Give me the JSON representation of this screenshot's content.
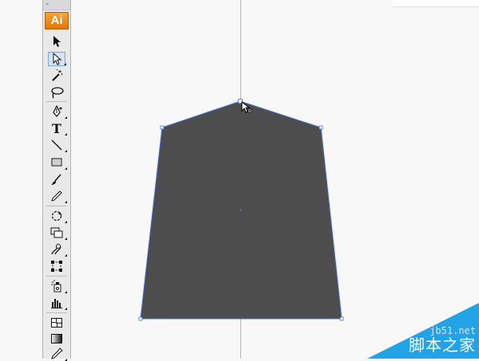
{
  "app": {
    "logo_text": "Ai",
    "toolbar_grip": "«"
  },
  "tools": [
    {
      "name": "selection-tool",
      "icon": "black-arrow-icon",
      "selected": false
    },
    {
      "name": "direct-selection-tool",
      "icon": "white-arrow-icon",
      "selected": true
    },
    {
      "name": "magic-wand-tool",
      "icon": "magic-wand-icon",
      "selected": false
    },
    {
      "name": "lasso-tool",
      "icon": "lasso-icon",
      "selected": false
    },
    {
      "name": "pen-tool",
      "icon": "pen-icon",
      "selected": false
    },
    {
      "name": "type-tool",
      "icon": "type-icon",
      "glyph": "T",
      "selected": false
    },
    {
      "name": "line-segment-tool",
      "icon": "line-icon",
      "selected": false
    },
    {
      "name": "rectangle-tool",
      "icon": "rectangle-icon",
      "selected": false
    },
    {
      "name": "paintbrush-tool",
      "icon": "brush-icon",
      "selected": false
    },
    {
      "name": "pencil-tool",
      "icon": "pencil-icon",
      "selected": false
    },
    {
      "name": "rotate-tool",
      "icon": "rotate-icon",
      "selected": false
    },
    {
      "name": "scale-tool",
      "icon": "scale-icon",
      "selected": false
    },
    {
      "name": "warp-tool",
      "icon": "warp-icon",
      "selected": false
    },
    {
      "name": "free-transform-tool",
      "icon": "free-transform-icon",
      "selected": false
    },
    {
      "name": "symbol-sprayer-tool",
      "icon": "symbol-sprayer-icon",
      "selected": false
    },
    {
      "name": "graph-tool",
      "icon": "column-graph-icon",
      "selected": false
    },
    {
      "name": "mesh-tool",
      "icon": "mesh-icon",
      "selected": false
    },
    {
      "name": "gradient-tool",
      "icon": "gradient-icon",
      "selected": false
    },
    {
      "name": "eyedropper-tool",
      "icon": "eyedropper-icon",
      "selected": false
    }
  ],
  "artwork": {
    "shape_fill": "#4d4d4d",
    "path_color": "#4a73d4",
    "guide_color": "#5fd8e6",
    "anchor_points_count": 5
  },
  "colors": {
    "logo_bg": "#f08c1e",
    "selection_highlight": "#d4e3f7",
    "watermark_blue": "#22a3e6"
  },
  "watermark": {
    "site": "jb51.net",
    "cn_text": "脚本之家"
  }
}
